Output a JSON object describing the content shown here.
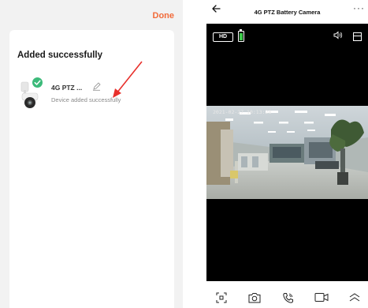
{
  "left": {
    "done_label": "Done",
    "title": "Added successfully",
    "device": {
      "name": "4G PTZ ...",
      "status": "Device added successfully"
    }
  },
  "right": {
    "title": "4G PTZ Battery Camera",
    "more": "···",
    "hd_label": "HD",
    "timestamp": "2021-02-27 10:13:28",
    "battery_level": 1.0,
    "icons": [
      "back-arrow-icon",
      "more-icon",
      "battery-icon",
      "speaker-icon",
      "layout-icon",
      "fullscreen-icon",
      "camera-icon",
      "phone-icon",
      "video-record-icon",
      "expand-up-icon"
    ]
  },
  "colors": {
    "accent": "#f26b3a",
    "check": "#3cba7a",
    "battery": "#3ec94b",
    "annotation_arrow": "#e8302c"
  }
}
